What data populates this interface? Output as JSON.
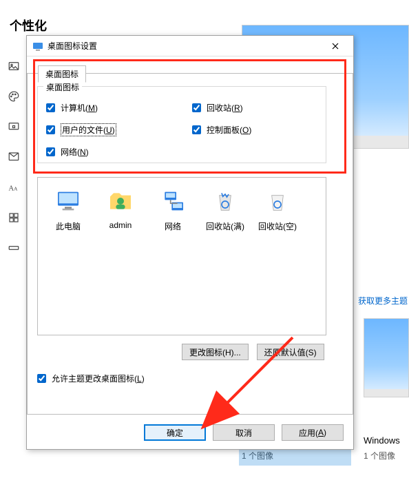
{
  "settings": {
    "header": "个性化"
  },
  "themes": {
    "more_link": "获取更多主题",
    "label1": "Windows",
    "sub1": "1 个图像",
    "sub2": "1 个图像"
  },
  "dialog": {
    "title": "桌面图标设置",
    "tab_label": "桌面图标",
    "group_title": "桌面图标",
    "checks": {
      "computer": {
        "label_pre": "计算机(",
        "key": "M",
        "label_post": ")",
        "checked": true
      },
      "recycle": {
        "label_pre": "回收站(",
        "key": "R",
        "label_post": ")",
        "checked": true
      },
      "userfiles": {
        "label_pre": "用户的文件(",
        "key": "U",
        "label_post": ")",
        "checked": true,
        "focused": true
      },
      "cpanel": {
        "label_pre": "控制面板(",
        "key": "O",
        "label_post": ")",
        "checked": true
      },
      "network": {
        "label_pre": "网络(",
        "key": "N",
        "label_post": ")",
        "checked": true
      }
    },
    "icons": [
      {
        "id": "thispc",
        "label": "此电脑"
      },
      {
        "id": "admin",
        "label": "admin"
      },
      {
        "id": "network",
        "label": "网络"
      },
      {
        "id": "bin_full",
        "label": "回收站(满)"
      },
      {
        "id": "bin_empty",
        "label": "回收站(空)"
      }
    ],
    "buttons": {
      "change_icon": "更改图标(H)...",
      "restore_default": "还原默认值(S)"
    },
    "allow_themes": {
      "label_pre": "允许主题更改桌面图标(",
      "key": "L",
      "label_post": ")",
      "checked": true
    },
    "footer": {
      "ok": "确定",
      "cancel": "取消",
      "apply_pre": "应用(",
      "apply_key": "A",
      "apply_post": ")"
    }
  }
}
